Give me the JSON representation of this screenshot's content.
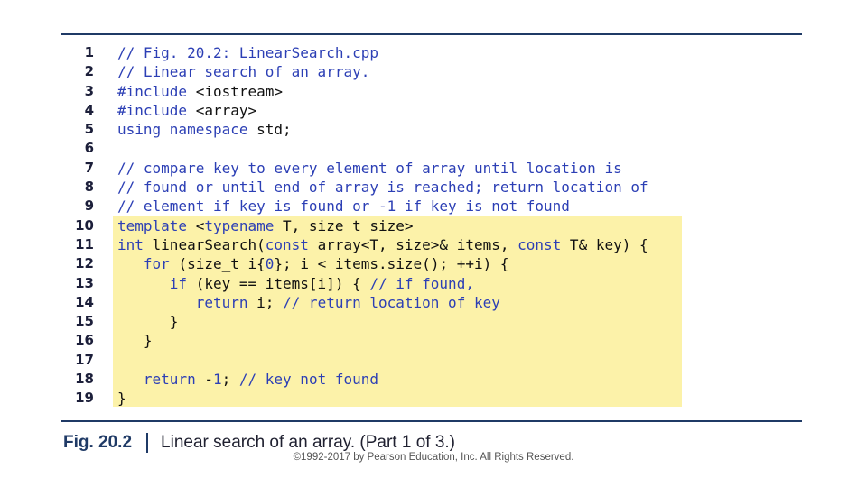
{
  "code_lines": [
    {
      "n": "1",
      "parts": [
        [
          "cm",
          "// Fig. 20.2: LinearSearch.cpp"
        ]
      ]
    },
    {
      "n": "2",
      "parts": [
        [
          "cm",
          "// Linear search of an array."
        ]
      ]
    },
    {
      "n": "3",
      "parts": [
        [
          "kw",
          "#include"
        ],
        [
          "",
          " <iostream>"
        ]
      ]
    },
    {
      "n": "4",
      "parts": [
        [
          "kw",
          "#include"
        ],
        [
          "",
          " <array>"
        ]
      ]
    },
    {
      "n": "5",
      "parts": [
        [
          "kw",
          "using namespace"
        ],
        [
          "",
          " std;"
        ]
      ]
    },
    {
      "n": "6",
      "parts": []
    },
    {
      "n": "7",
      "parts": [
        [
          "cm",
          "// compare key to every element of array until location is"
        ]
      ]
    },
    {
      "n": "8",
      "parts": [
        [
          "cm",
          "// found or until end of array is reached; return location of"
        ]
      ]
    },
    {
      "n": "9",
      "parts": [
        [
          "cm",
          "// element if key is found or -1 if key is not found"
        ]
      ]
    },
    {
      "n": "10",
      "parts": [
        [
          "kw",
          "template"
        ],
        [
          "",
          " <"
        ],
        [
          "kw",
          "typename"
        ],
        [
          "",
          " T, size_t size>"
        ]
      ]
    },
    {
      "n": "11",
      "parts": [
        [
          "kw",
          "int"
        ],
        [
          "",
          " linearSearch("
        ],
        [
          "kw",
          "const"
        ],
        [
          "",
          " array<T, size>& items, "
        ],
        [
          "kw",
          "const"
        ],
        [
          "",
          " T& key) {"
        ]
      ]
    },
    {
      "n": "12",
      "parts": [
        [
          "",
          "   "
        ],
        [
          "kw",
          "for"
        ],
        [
          "",
          " (size_t i{"
        ],
        [
          "nm",
          "0"
        ],
        [
          "",
          "}; i < items.size(); ++i) {"
        ]
      ]
    },
    {
      "n": "13",
      "parts": [
        [
          "",
          "      "
        ],
        [
          "kw",
          "if"
        ],
        [
          "",
          " (key == items[i]) { "
        ],
        [
          "cm",
          "// if found,"
        ]
      ]
    },
    {
      "n": "14",
      "parts": [
        [
          "",
          "         "
        ],
        [
          "kw",
          "return"
        ],
        [
          "",
          " i; "
        ],
        [
          "cm",
          "// return location of key"
        ]
      ]
    },
    {
      "n": "15",
      "parts": [
        [
          "",
          "      }"
        ]
      ]
    },
    {
      "n": "16",
      "parts": [
        [
          "",
          "   }"
        ]
      ]
    },
    {
      "n": "17",
      "parts": []
    },
    {
      "n": "18",
      "parts": [
        [
          "",
          "   "
        ],
        [
          "kw",
          "return"
        ],
        [
          "",
          " -"
        ],
        [
          "nm",
          "1"
        ],
        [
          "",
          "; "
        ],
        [
          "cm",
          "// key not found"
        ]
      ]
    },
    {
      "n": "19",
      "parts": [
        [
          "",
          "}"
        ]
      ]
    }
  ],
  "caption": {
    "figure_number": "Fig. 20.2",
    "text": "Linear search of an array. (Part 1 of 3.)"
  },
  "copyright": "©1992-2017 by Pearson Education, Inc. All Rights Reserved.",
  "colors": {
    "highlight": "#fcf2a9",
    "keyword": "#2c3fb5",
    "rule": "#1f3a66"
  }
}
